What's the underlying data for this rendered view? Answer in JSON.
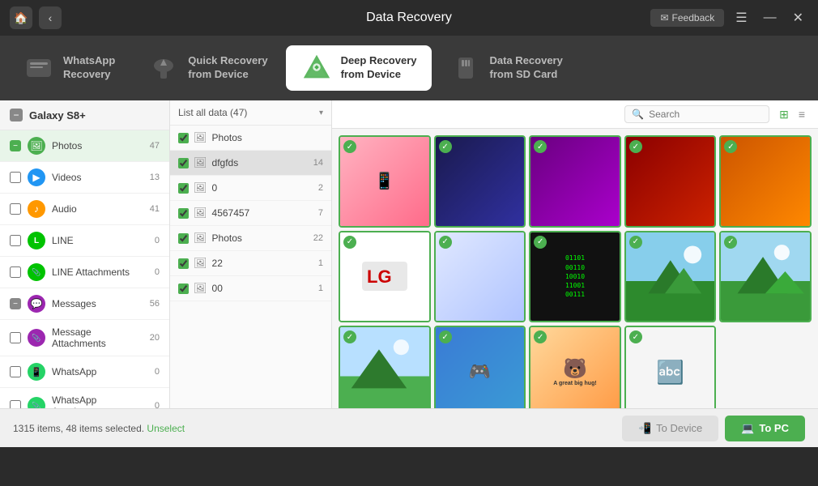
{
  "app": {
    "title": "Data Recovery",
    "feedback_label": "Feedback"
  },
  "window_controls": {
    "menu": "☰",
    "minimize": "—",
    "close": "✕"
  },
  "nav": {
    "tabs": [
      {
        "id": "whatsapp",
        "icon": "📱",
        "line1": "WhatsApp",
        "line2": "Recovery",
        "active": false
      },
      {
        "id": "quick",
        "icon": "⚡",
        "line1": "Quick Recovery",
        "line2": "from Device",
        "active": false
      },
      {
        "id": "deep",
        "icon": "🔄",
        "line1": "Deep Recovery",
        "line2": "from Device",
        "active": true
      },
      {
        "id": "sd",
        "icon": "💾",
        "line1": "Data Recovery",
        "line2": "from SD Card",
        "active": false
      }
    ]
  },
  "sidebar": {
    "device": "Galaxy S8+",
    "items": [
      {
        "label": "Photos",
        "count": 47,
        "type": "photos",
        "checked": true,
        "partial": false
      },
      {
        "label": "Videos",
        "count": 13,
        "type": "videos",
        "checked": false,
        "partial": false
      },
      {
        "label": "Audio",
        "count": 41,
        "type": "audio",
        "checked": false,
        "partial": false
      },
      {
        "label": "LINE",
        "count": 0,
        "type": "line",
        "checked": false,
        "partial": false
      },
      {
        "label": "LINE Attachments",
        "count": 0,
        "type": "line-att",
        "checked": false,
        "partial": false
      },
      {
        "label": "Messages",
        "count": 56,
        "type": "messages",
        "checked": false,
        "partial": true
      },
      {
        "label": "Message Attachments",
        "count": 20,
        "type": "msg-att",
        "checked": false,
        "partial": false
      },
      {
        "label": "WhatsApp",
        "count": 0,
        "type": "whatsapp",
        "checked": false,
        "partial": false
      },
      {
        "label": "WhatsApp Attachments",
        "count": 0,
        "type": "whatsapp-att",
        "checked": false,
        "partial": false
      }
    ]
  },
  "mid_panel": {
    "header": "List all data (47)",
    "folders": [
      {
        "name": "Photos",
        "count": null
      },
      {
        "name": "dfgfds",
        "count": 14,
        "checked": true,
        "active": true
      },
      {
        "name": "0",
        "count": 2,
        "checked": true
      },
      {
        "name": "4567457",
        "count": 7,
        "checked": true
      },
      {
        "name": "Photos",
        "count": 22,
        "checked": true
      },
      {
        "name": "22",
        "count": 1,
        "checked": true
      },
      {
        "name": "00",
        "count": 1,
        "checked": true
      }
    ]
  },
  "toolbar": {
    "search_placeholder": "Search",
    "view_grid": "⊞",
    "view_list": "≡"
  },
  "bottom": {
    "info": "1315 items, 48 items selected.",
    "unselect": "Unselect",
    "to_device": "To Device",
    "to_pc": "To PC"
  }
}
